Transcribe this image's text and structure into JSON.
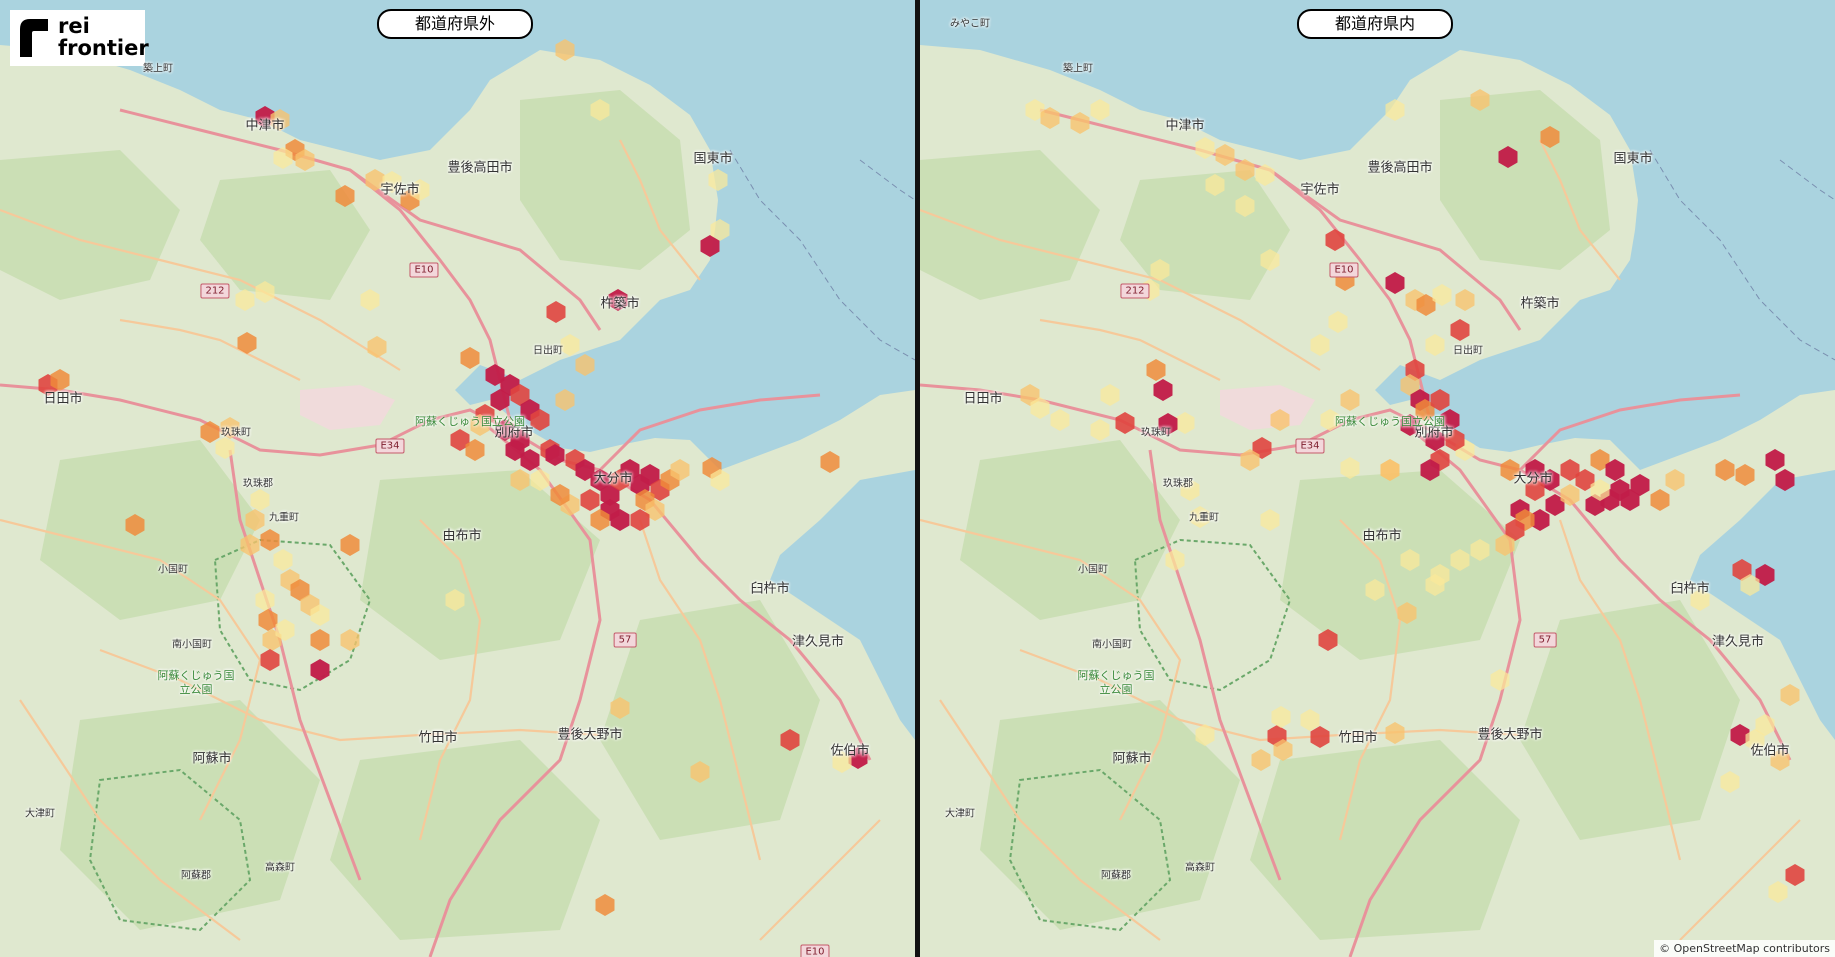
{
  "logo": {
    "line1": "rei",
    "line2": "frontier"
  },
  "attribution": "© OpenStreetMap contributors",
  "colors": {
    "sea": "#aad3df",
    "land": "#dfe8cf",
    "forest": "#c5dcae",
    "road_major": "#e8929b",
    "road_minor": "#f6c99a",
    "hex_scale": [
      "#fbe99a",
      "#f9c36d",
      "#f08a3a",
      "#e0453f",
      "#c21d49"
    ]
  },
  "panels": [
    {
      "id": "left",
      "title": "都道府県外",
      "places": [
        {
          "name": "中津市",
          "size": "normal"
        },
        {
          "name": "豊後高田市",
          "size": "normal"
        },
        {
          "name": "国東市",
          "size": "normal"
        },
        {
          "name": "宇佐市",
          "size": "normal"
        },
        {
          "name": "杵築市",
          "size": "normal"
        },
        {
          "name": "日出町",
          "size": "small"
        },
        {
          "name": "日田市",
          "size": "normal"
        },
        {
          "name": "玖珠町",
          "size": "small"
        },
        {
          "name": "別府市",
          "size": "normal"
        },
        {
          "name": "大分市",
          "size": "normal"
        },
        {
          "name": "由布市",
          "size": "normal"
        },
        {
          "name": "九重町",
          "size": "small"
        },
        {
          "name": "小国町",
          "size": "small"
        },
        {
          "name": "南小国町",
          "size": "small"
        },
        {
          "name": "臼杵市",
          "size": "normal"
        },
        {
          "name": "津久見市",
          "size": "normal"
        },
        {
          "name": "竹田市",
          "size": "normal"
        },
        {
          "name": "豊後大野市",
          "size": "normal"
        },
        {
          "name": "佐伯市",
          "size": "normal"
        },
        {
          "name": "阿蘇市",
          "size": "normal"
        },
        {
          "name": "大津町",
          "size": "small"
        },
        {
          "name": "高森町",
          "size": "small"
        },
        {
          "name": "築上町",
          "size": "small"
        },
        {
          "name": "玖珠郡",
          "size": "small"
        },
        {
          "name": "阿蘇郡",
          "size": "small"
        }
      ],
      "parks": [
        "阿蘇くじゅう国立公園",
        "阿蘇くじゅう国立公園"
      ],
      "shields": [
        "212",
        "E10",
        "E34",
        "57",
        "E10"
      ]
    },
    {
      "id": "right",
      "title": "都道府県内",
      "places": [
        {
          "name": "みやこ町",
          "size": "small"
        },
        {
          "name": "築上町",
          "size": "small"
        },
        {
          "name": "中津市",
          "size": "normal"
        },
        {
          "name": "豊後高田市",
          "size": "normal"
        },
        {
          "name": "国東市",
          "size": "normal"
        },
        {
          "name": "宇佐市",
          "size": "normal"
        },
        {
          "name": "杵築市",
          "size": "normal"
        },
        {
          "name": "日出町",
          "size": "small"
        },
        {
          "name": "日田市",
          "size": "normal"
        },
        {
          "name": "玖珠町",
          "size": "small"
        },
        {
          "name": "別府市",
          "size": "normal"
        },
        {
          "name": "大分市",
          "size": "normal"
        },
        {
          "name": "由布市",
          "size": "normal"
        },
        {
          "name": "九重町",
          "size": "small"
        },
        {
          "name": "小国町",
          "size": "small"
        },
        {
          "name": "南小国町",
          "size": "small"
        },
        {
          "name": "臼杵市",
          "size": "normal"
        },
        {
          "name": "津久見市",
          "size": "normal"
        },
        {
          "name": "竹田市",
          "size": "normal"
        },
        {
          "name": "豊後大野市",
          "size": "normal"
        },
        {
          "name": "佐伯市",
          "size": "normal"
        },
        {
          "name": "阿蘇市",
          "size": "normal"
        },
        {
          "name": "大津町",
          "size": "small"
        },
        {
          "name": "高森町",
          "size": "small"
        },
        {
          "name": "玖珠郡",
          "size": "small"
        },
        {
          "name": "阿蘇郡",
          "size": "small"
        }
      ],
      "parks": [
        "阿蘇くじゅう国立公園",
        "阿蘇くじゅう国立公園"
      ],
      "shields": [
        "212",
        "E10",
        "E34",
        "57"
      ]
    }
  ]
}
